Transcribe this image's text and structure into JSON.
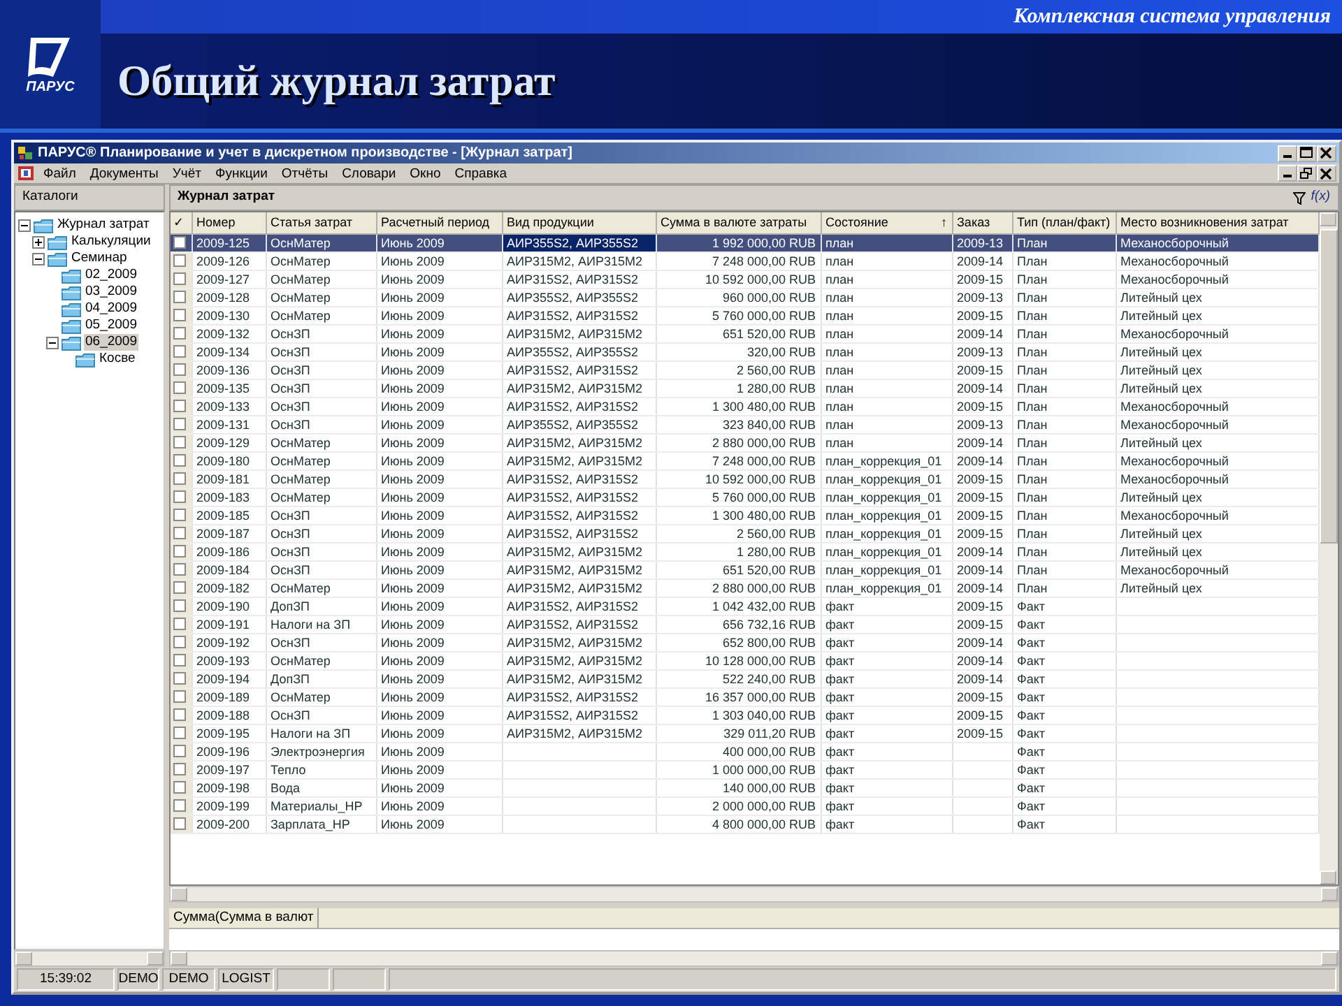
{
  "slide": {
    "logo": "ПАРУС",
    "tagline": "Комплексная система управления",
    "title": "Общий журнал затрат"
  },
  "window": {
    "title": "ПАРУС® Планирование и учет в дискретном производстве - [Журнал затрат]"
  },
  "menu": [
    "Файл",
    "Документы",
    "Учёт",
    "Функции",
    "Отчёты",
    "Словари",
    "Окно",
    "Справка"
  ],
  "catalog": {
    "title": "Каталоги",
    "tree": [
      {
        "label": "Журнал затрат",
        "expanded": true,
        "selected": false,
        "children": [
          {
            "label": "Калькуляции",
            "expanded": false,
            "selected": false
          },
          {
            "label": "Семинар",
            "expanded": true,
            "selected": false,
            "children": [
              {
                "label": "02_2009",
                "selected": false
              },
              {
                "label": "03_2009",
                "selected": false
              },
              {
                "label": "04_2009",
                "selected": false
              },
              {
                "label": "05_2009",
                "selected": false
              },
              {
                "label": "06_2009",
                "expanded": true,
                "selected": true,
                "children": [
                  {
                    "label": "Косве",
                    "selected": false
                  }
                ]
              }
            ]
          }
        ]
      }
    ]
  },
  "journal": {
    "title": "Журнал затрат",
    "formula_label": "f(x)",
    "check_header": "✓",
    "columns": [
      {
        "label": "Номер",
        "kind": "text"
      },
      {
        "label": "Статья затрат",
        "kind": "text"
      },
      {
        "label": "Расчетный период",
        "kind": "text"
      },
      {
        "label": "Вид продукции",
        "kind": "text"
      },
      {
        "label": "Сумма в валюте затраты",
        "kind": "money"
      },
      {
        "label": "Состояние",
        "kind": "text",
        "sort": "↑"
      },
      {
        "label": "Заказ",
        "kind": "text"
      },
      {
        "label": "Тип (план/факт)",
        "kind": "text"
      },
      {
        "label": "Место возникновения затрат",
        "kind": "text"
      }
    ],
    "rows": [
      {
        "checked": false,
        "selected": true,
        "cells": [
          "2009-125",
          "ОснМатер",
          "Июнь 2009",
          "АИР355S2, АИР355S2",
          "1 992 000,00 RUB",
          "план",
          "2009-13",
          "План",
          "Механосборочный"
        ]
      },
      {
        "checked": false,
        "selected": false,
        "cells": [
          "2009-126",
          "ОснМатер",
          "Июнь 2009",
          "АИР315М2, АИР315М2",
          "7 248 000,00 RUB",
          "план",
          "2009-14",
          "План",
          "Механосборочный"
        ]
      },
      {
        "checked": false,
        "selected": false,
        "cells": [
          "2009-127",
          "ОснМатер",
          "Июнь 2009",
          "АИР315S2, АИР315S2",
          "10 592 000,00 RUB",
          "план",
          "2009-15",
          "План",
          "Механосборочный"
        ]
      },
      {
        "checked": false,
        "selected": false,
        "cells": [
          "2009-128",
          "ОснМатер",
          "Июнь 2009",
          "АИР355S2, АИР355S2",
          "960 000,00 RUB",
          "план",
          "2009-13",
          "План",
          "Литейный цех"
        ]
      },
      {
        "checked": false,
        "selected": false,
        "cells": [
          "2009-130",
          "ОснМатер",
          "Июнь 2009",
          "АИР315S2, АИР315S2",
          "5 760 000,00 RUB",
          "план",
          "2009-15",
          "План",
          "Литейный цех"
        ]
      },
      {
        "checked": false,
        "selected": false,
        "cells": [
          "2009-132",
          "ОснЗП",
          "Июнь 2009",
          "АИР315М2, АИР315М2",
          "651 520,00 RUB",
          "план",
          "2009-14",
          "План",
          "Механосборочный"
        ]
      },
      {
        "checked": false,
        "selected": false,
        "cells": [
          "2009-134",
          "ОснЗП",
          "Июнь 2009",
          "АИР355S2, АИР355S2",
          "320,00 RUB",
          "план",
          "2009-13",
          "План",
          "Литейный цех"
        ]
      },
      {
        "checked": false,
        "selected": false,
        "cells": [
          "2009-136",
          "ОснЗП",
          "Июнь 2009",
          "АИР315S2, АИР315S2",
          "2 560,00 RUB",
          "план",
          "2009-15",
          "План",
          "Литейный цех"
        ]
      },
      {
        "checked": false,
        "selected": false,
        "cells": [
          "2009-135",
          "ОснЗП",
          "Июнь 2009",
          "АИР315М2, АИР315М2",
          "1 280,00 RUB",
          "план",
          "2009-14",
          "План",
          "Литейный цех"
        ]
      },
      {
        "checked": false,
        "selected": false,
        "cells": [
          "2009-133",
          "ОснЗП",
          "Июнь 2009",
          "АИР315S2, АИР315S2",
          "1 300 480,00 RUB",
          "план",
          "2009-15",
          "План",
          "Механосборочный"
        ]
      },
      {
        "checked": false,
        "selected": false,
        "cells": [
          "2009-131",
          "ОснЗП",
          "Июнь 2009",
          "АИР355S2, АИР355S2",
          "323 840,00 RUB",
          "план",
          "2009-13",
          "План",
          "Механосборочный"
        ]
      },
      {
        "checked": false,
        "selected": false,
        "cells": [
          "2009-129",
          "ОснМатер",
          "Июнь 2009",
          "АИР315М2, АИР315М2",
          "2 880 000,00 RUB",
          "план",
          "2009-14",
          "План",
          "Литейный цех"
        ]
      },
      {
        "checked": false,
        "selected": false,
        "cells": [
          "2009-180",
          "ОснМатер",
          "Июнь 2009",
          "АИР315М2, АИР315М2",
          "7 248 000,00 RUB",
          "план_коррекция_01",
          "2009-14",
          "План",
          "Механосборочный"
        ]
      },
      {
        "checked": false,
        "selected": false,
        "cells": [
          "2009-181",
          "ОснМатер",
          "Июнь 2009",
          "АИР315S2, АИР315S2",
          "10 592 000,00 RUB",
          "план_коррекция_01",
          "2009-15",
          "План",
          "Механосборочный"
        ]
      },
      {
        "checked": false,
        "selected": false,
        "cells": [
          "2009-183",
          "ОснМатер",
          "Июнь 2009",
          "АИР315S2, АИР315S2",
          "5 760 000,00 RUB",
          "план_коррекция_01",
          "2009-15",
          "План",
          "Литейный цех"
        ]
      },
      {
        "checked": false,
        "selected": false,
        "cells": [
          "2009-185",
          "ОснЗП",
          "Июнь 2009",
          "АИР315S2, АИР315S2",
          "1 300 480,00 RUB",
          "план_коррекция_01",
          "2009-15",
          "План",
          "Механосборочный"
        ]
      },
      {
        "checked": false,
        "selected": false,
        "cells": [
          "2009-187",
          "ОснЗП",
          "Июнь 2009",
          "АИР315S2, АИР315S2",
          "2 560,00 RUB",
          "план_коррекция_01",
          "2009-15",
          "План",
          "Литейный цех"
        ]
      },
      {
        "checked": false,
        "selected": false,
        "cells": [
          "2009-186",
          "ОснЗП",
          "Июнь 2009",
          "АИР315М2, АИР315М2",
          "1 280,00 RUB",
          "план_коррекция_01",
          "2009-14",
          "План",
          "Литейный цех"
        ]
      },
      {
        "checked": false,
        "selected": false,
        "cells": [
          "2009-184",
          "ОснЗП",
          "Июнь 2009",
          "АИР315М2, АИР315М2",
          "651 520,00 RUB",
          "план_коррекция_01",
          "2009-14",
          "План",
          "Механосборочный"
        ]
      },
      {
        "checked": false,
        "selected": false,
        "cells": [
          "2009-182",
          "ОснМатер",
          "Июнь 2009",
          "АИР315М2, АИР315М2",
          "2 880 000,00 RUB",
          "план_коррекция_01",
          "2009-14",
          "План",
          "Литейный цех"
        ]
      },
      {
        "checked": false,
        "selected": false,
        "cells": [
          "2009-190",
          "ДопЗП",
          "Июнь 2009",
          "АИР315S2, АИР315S2",
          "1 042 432,00 RUB",
          "факт",
          "2009-15",
          "Факт",
          null
        ]
      },
      {
        "checked": false,
        "selected": false,
        "cells": [
          "2009-191",
          "Налоги на ЗП",
          "Июнь 2009",
          "АИР315S2, АИР315S2",
          "656 732,16 RUB",
          "факт",
          "2009-15",
          "Факт",
          null
        ]
      },
      {
        "checked": false,
        "selected": false,
        "cells": [
          "2009-192",
          "ОснЗП",
          "Июнь 2009",
          "АИР315М2, АИР315М2",
          "652 800,00 RUB",
          "факт",
          "2009-14",
          "Факт",
          null
        ]
      },
      {
        "checked": false,
        "selected": false,
        "cells": [
          "2009-193",
          "ОснМатер",
          "Июнь 2009",
          "АИР315М2, АИР315М2",
          "10 128 000,00 RUB",
          "факт",
          "2009-14",
          "Факт",
          null
        ]
      },
      {
        "checked": false,
        "selected": false,
        "cells": [
          "2009-194",
          "ДопЗП",
          "Июнь 2009",
          "АИР315М2, АИР315М2",
          "522 240,00 RUB",
          "факт",
          "2009-14",
          "Факт",
          null
        ]
      },
      {
        "checked": false,
        "selected": false,
        "cells": [
          "2009-189",
          "ОснМатер",
          "Июнь 2009",
          "АИР315S2, АИР315S2",
          "16 357 000,00 RUB",
          "факт",
          "2009-15",
          "Факт",
          null
        ]
      },
      {
        "checked": false,
        "selected": false,
        "cells": [
          "2009-188",
          "ОснЗП",
          "Июнь 2009",
          "АИР315S2, АИР315S2",
          "1 303 040,00 RUB",
          "факт",
          "2009-15",
          "Факт",
          null
        ]
      },
      {
        "checked": false,
        "selected": false,
        "cells": [
          "2009-195",
          "Налоги на ЗП",
          "Июнь 2009",
          "АИР315М2, АИР315М2",
          "329 011,20 RUB",
          "факт",
          "2009-15",
          "Факт",
          null
        ]
      },
      {
        "checked": false,
        "selected": false,
        "cells": [
          "2009-196",
          "Электроэнергия",
          "Июнь 2009",
          null,
          "400 000,00 RUB",
          "факт",
          null,
          "Факт",
          null
        ]
      },
      {
        "checked": false,
        "selected": false,
        "cells": [
          "2009-197",
          "Тепло",
          "Июнь 2009",
          null,
          "1 000 000,00 RUB",
          "факт",
          null,
          "Факт",
          null
        ]
      },
      {
        "checked": false,
        "selected": false,
        "cells": [
          "2009-198",
          "Вода",
          "Июнь 2009",
          null,
          "140 000,00 RUB",
          "факт",
          null,
          "Факт",
          null
        ]
      },
      {
        "checked": false,
        "selected": false,
        "cells": [
          "2009-199",
          "Материалы_НР",
          "Июнь 2009",
          null,
          "2 000 000,00 RUB",
          "факт",
          null,
          "Факт",
          null
        ]
      },
      {
        "checked": false,
        "selected": false,
        "cells": [
          "2009-200",
          "Зарплата_НР",
          "Июнь 2009",
          null,
          "4 800 000,00 RUB",
          "факт",
          null,
          "Факт",
          null
        ]
      }
    ]
  },
  "summary": {
    "header": "Сумма(Сумма в валют"
  },
  "status_bar": [
    "15:39:02",
    "DEMO",
    "DEMO",
    "LOGIST"
  ]
}
